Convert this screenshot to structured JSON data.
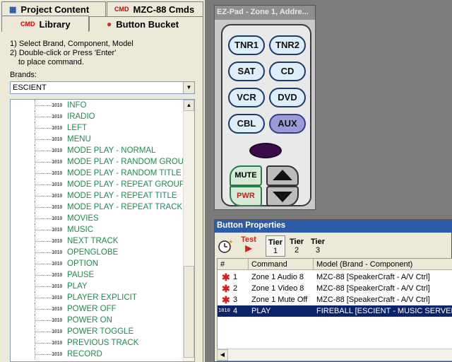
{
  "tabs": {
    "project_content": "Project Content",
    "mzc_cmds": "MZC-88 Cmds",
    "library": "Library",
    "button_bucket": "Button Bucket",
    "cmd_icon": "CMD"
  },
  "instructions": {
    "line1": "1) Select Brand, Component, Model",
    "line2": "2) Double-click or Press 'Enter'",
    "line3": "to place command."
  },
  "brands": {
    "label": "Brands:",
    "selected": "ESCIENT"
  },
  "commands": {
    "code_icon": "1010",
    "items": [
      "INFO",
      "IRADIO",
      "LEFT",
      "MENU",
      "MODE PLAY - NORMAL",
      "MODE PLAY - RANDOM GROUP",
      "MODE PLAY - RANDOM TITLE",
      "MODE PLAY - REPEAT GROUP",
      "MODE PLAY - REPEAT TITLE",
      "MODE PLAY - REPEAT TRACK",
      "MOVIES",
      "MUSIC",
      "NEXT TRACK",
      "OPENGLOBE",
      "OPTION",
      "PAUSE",
      "PLAY",
      "PLAYER EXPLICIT",
      "POWER OFF",
      "POWER ON",
      "POWER TOGGLE",
      "PREVIOUS TRACK",
      "RECORD"
    ]
  },
  "ezpad": {
    "title": "EZ-Pad - Zone 1, Addre...",
    "buttons": [
      "TNR1",
      "TNR2",
      "SAT",
      "CD",
      "VCR",
      "DVD",
      "CBL",
      "AUX"
    ],
    "mute": "MUTE",
    "pwr": "PWR"
  },
  "button_properties": {
    "title": "Button Properties",
    "test": "Test",
    "tiers": [
      {
        "label": "Tier",
        "num": "1"
      },
      {
        "label": "Tier",
        "num": "2"
      },
      {
        "label": "Tier",
        "num": "3"
      }
    ],
    "columns": [
      "#",
      "Command",
      "Model (Brand - Component)"
    ],
    "rows": [
      {
        "num": "1",
        "command": "Zone 1 Audio 8",
        "model": "MZC-88 [SpeakerCraft - A/V Ctrl]"
      },
      {
        "num": "2",
        "command": "Zone 1 Video 8",
        "model": "MZC-88 [SpeakerCraft - A/V Ctrl]"
      },
      {
        "num": "3",
        "command": "Zone 1 Mute Off",
        "model": "MZC-88 [SpeakerCraft - A/V Ctrl]"
      },
      {
        "num": "4",
        "command": "PLAY",
        "model": "FIREBALL [ESCIENT - MUSIC SERVER]"
      }
    ]
  }
}
